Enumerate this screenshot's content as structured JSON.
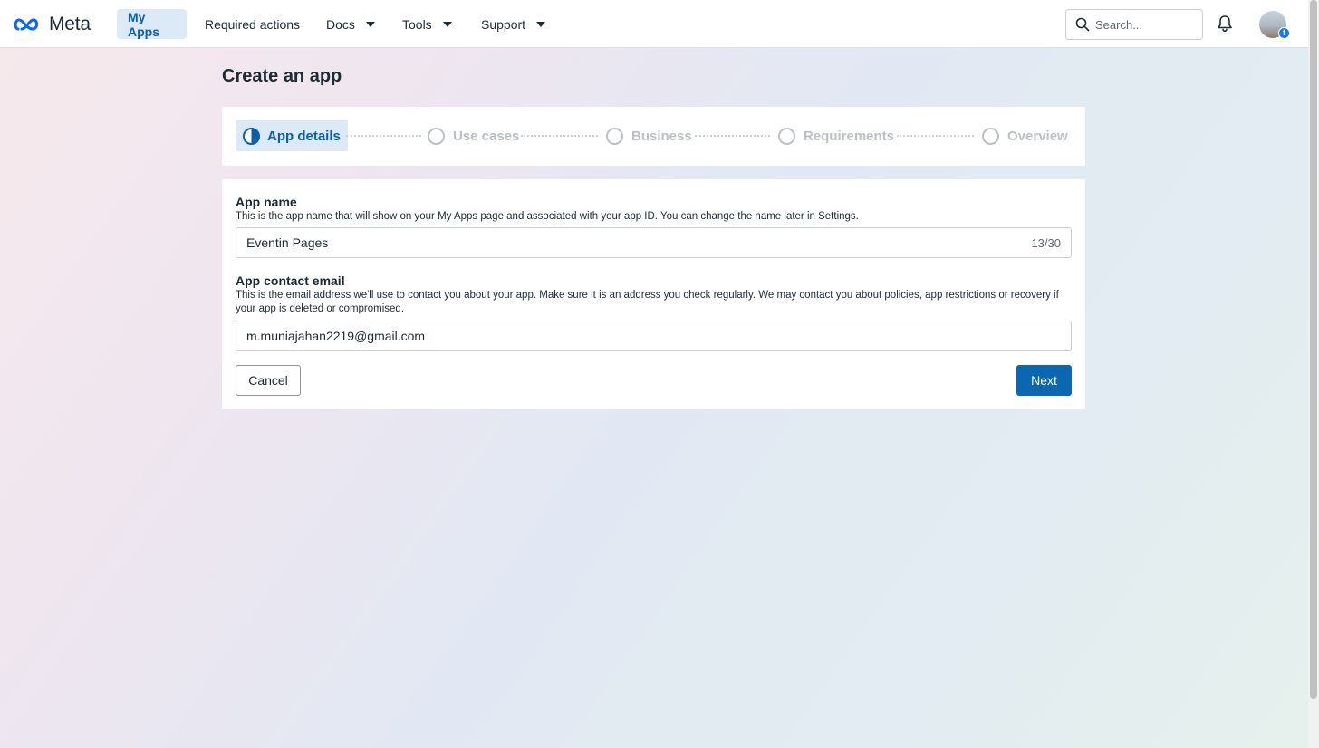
{
  "nav": {
    "logo_text": "Meta",
    "items": [
      {
        "label": "My Apps"
      },
      {
        "label": "Required actions"
      },
      {
        "label": "Docs"
      },
      {
        "label": "Tools"
      },
      {
        "label": "Support"
      }
    ],
    "search_placeholder": "Search..."
  },
  "page": {
    "title": "Create an app"
  },
  "steps": [
    {
      "label": "App details",
      "state": "current"
    },
    {
      "label": "Use cases",
      "state": "pending"
    },
    {
      "label": "Business",
      "state": "pending"
    },
    {
      "label": "Requirements",
      "state": "pending"
    },
    {
      "label": "Overview",
      "state": "pending"
    }
  ],
  "form": {
    "app_name": {
      "label": "App name",
      "hint": "This is the app name that will show on your My Apps page and associated with your app ID. You can change the name later in Settings.",
      "value": "Eventin Pages",
      "counter": "13/30"
    },
    "contact_email": {
      "label": "App contact email",
      "hint": "This is the email address we'll use to contact you about your app. Make sure it is an address you check regularly. We may contact you about policies, app restrictions or recovery if your app is deleted or compromised.",
      "value": "m.muniajahan2219@gmail.com"
    },
    "cancel_label": "Cancel",
    "next_label": "Next"
  },
  "colors": {
    "accent": "#0a67b0",
    "active_nav_bg": "#dce9f6",
    "facebook_blue": "#1877f2"
  }
}
